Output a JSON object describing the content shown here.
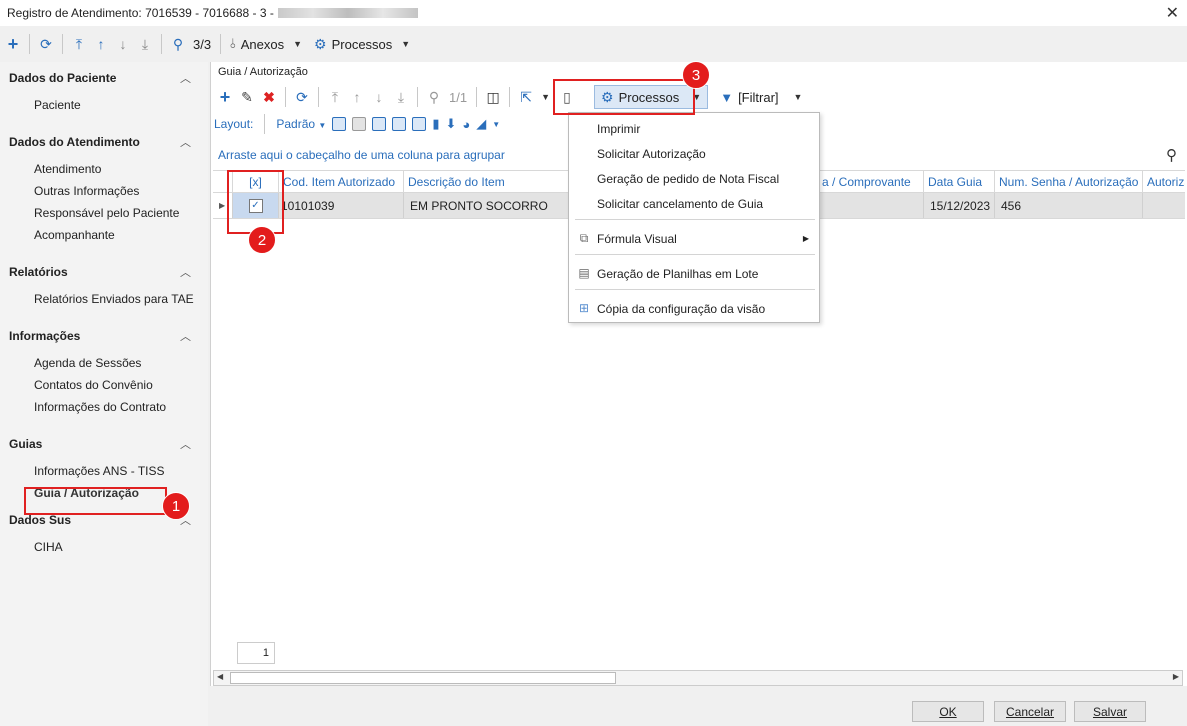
{
  "window": {
    "title": "Registro de Atendimento: 7016539 - 7016688 - 3 -"
  },
  "toolbar": {
    "record_count": "3/3",
    "anexos_label": "Anexos",
    "processos_label": "Processos"
  },
  "sidebar": {
    "groups": [
      {
        "label": "Dados do Paciente",
        "items": [
          "Paciente"
        ]
      },
      {
        "label": "Dados do Atendimento",
        "items": [
          "Atendimento",
          "Outras Informações",
          "Responsável pelo Paciente",
          "Acompanhante"
        ]
      },
      {
        "label": "Relatórios",
        "items": [
          "Relatórios Enviados para TAE"
        ]
      },
      {
        "label": "Informações",
        "items": [
          "Agenda de Sessões",
          "Contatos do Convênio",
          "Informações do Contrato"
        ]
      },
      {
        "label": "Guias",
        "items": [
          "Informações ANS - TISS",
          "Guia / Autorização"
        ]
      },
      {
        "label": "Dados Sus",
        "items": [
          "CIHA"
        ]
      }
    ]
  },
  "content": {
    "breadcrumb": "Guia / Autorização",
    "record_pos": "1/1",
    "processos_label": "Processos",
    "filter_label": "[Filtrar]",
    "layout_label": "Layout:",
    "layout_value": "Padrão",
    "group_hint": "Arraste aqui o cabeçalho de uma coluna para agrupar",
    "columns": [
      "[x]",
      "Cod. Item Autorizado",
      "Descrição do Item",
      "a / Comprovante",
      "Data Guia",
      "Num. Senha / Autorização",
      "Autoriza"
    ],
    "rows": [
      {
        "cod": "10101039",
        "descricao": "EM PRONTO SOCORRO",
        "comprovante": "",
        "data": "15/12/2023",
        "senha": "456",
        "autoriza": ""
      }
    ],
    "page": "1"
  },
  "menu": {
    "items": [
      "Imprimir",
      "Solicitar Autorização",
      "Geração de pedido de Nota Fiscal",
      "Solicitar cancelamento de Guia"
    ],
    "formula": "Fórmula Visual",
    "planilhas": "Geração de Planilhas em Lote",
    "copia": "Cópia da configuração da visão"
  },
  "annotations": [
    "1",
    "2",
    "3"
  ],
  "buttons": {
    "ok": "OK",
    "cancel": "Cancelar",
    "save": "Salvar"
  },
  "colors": {
    "accent": "#2a6ebb",
    "annotation_red": "#e31c1c"
  }
}
